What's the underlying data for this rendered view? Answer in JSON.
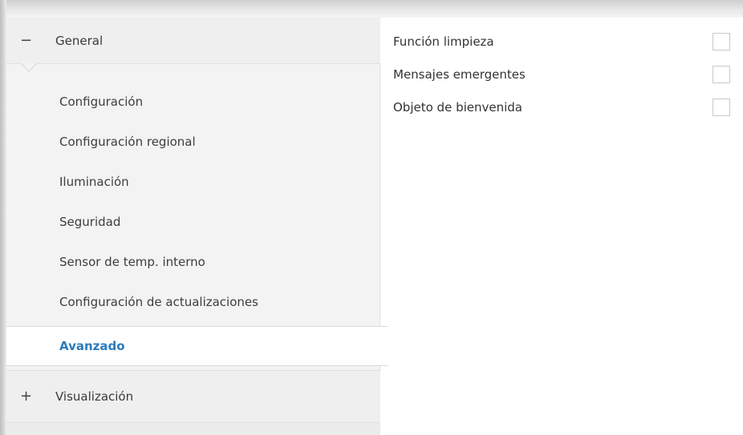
{
  "sidebar": {
    "groups": [
      {
        "label": "General",
        "toggle": "−",
        "expanded": true,
        "items": [
          {
            "label": "Configuración"
          },
          {
            "label": "Configuración regional"
          },
          {
            "label": "Iluminación"
          },
          {
            "label": "Seguridad"
          },
          {
            "label": "Sensor de temp. interno"
          },
          {
            "label": "Configuración de actualizaciones"
          },
          {
            "label": "Avanzado",
            "selected": true
          }
        ]
      },
      {
        "label": "Visualización",
        "toggle": "+",
        "expanded": false
      }
    ]
  },
  "main": {
    "parameters": [
      {
        "label": "Función limpieza",
        "checked": false
      },
      {
        "label": "Mensajes emergentes",
        "checked": false
      },
      {
        "label": "Objeto de bienvenida",
        "checked": false
      }
    ]
  },
  "colors": {
    "accent": "#2a7bbd",
    "panel_bg": "#f3f3f3",
    "selected_bg": "#ffffff"
  }
}
